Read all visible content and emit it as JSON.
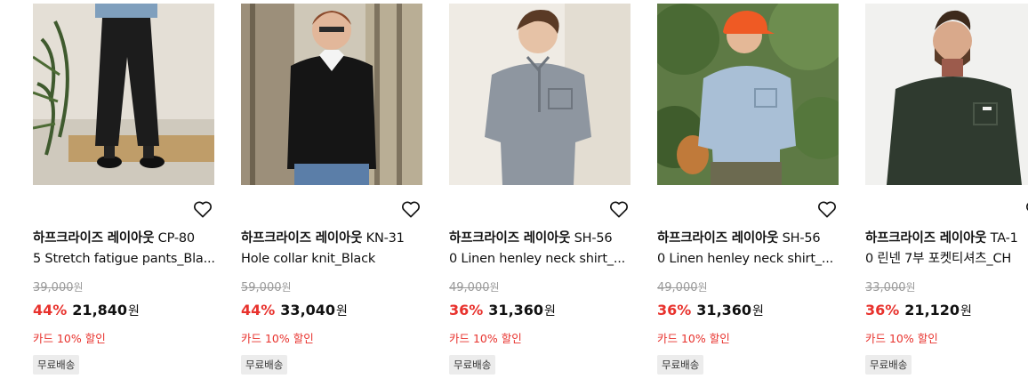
{
  "products": [
    {
      "brand": "하프크라이즈 레이아웃",
      "title_rest_line1": "CP-80",
      "title_line2": "5 Stretch fatigue pants_Bla...",
      "original_price": "39,000",
      "discount_percent": "44%",
      "sale_price": "21,840",
      "currency": "원",
      "card_discount": "카드 10% 할인",
      "shipping_badge": "무료배송",
      "image_desc": "black-pants-model",
      "favorite_icon": "heart-outline-icon"
    },
    {
      "brand": "하프크라이즈 레이아웃",
      "title_rest_line1": "KN-31",
      "title_line2": "Hole collar knit_Black",
      "original_price": "59,000",
      "discount_percent": "44%",
      "sale_price": "33,040",
      "currency": "원",
      "card_discount": "카드 10% 할인",
      "shipping_badge": "무료배송",
      "image_desc": "black-knit-model",
      "favorite_icon": "heart-outline-icon"
    },
    {
      "brand": "하프크라이즈 레이아웃",
      "title_rest_line1": "SH-56",
      "title_line2": "0 Linen henley neck shirt_...",
      "original_price": "49,000",
      "discount_percent": "36%",
      "sale_price": "31,360",
      "currency": "원",
      "card_discount": "카드 10% 할인",
      "shipping_badge": "무료배송",
      "image_desc": "grey-linen-shirt-model",
      "favorite_icon": "heart-outline-icon"
    },
    {
      "brand": "하프크라이즈 레이아웃",
      "title_rest_line1": "SH-56",
      "title_line2": "0 Linen henley neck shirt_...",
      "original_price": "49,000",
      "discount_percent": "36%",
      "sale_price": "31,360",
      "currency": "원",
      "card_discount": "카드 10% 할인",
      "shipping_badge": "무료배송",
      "image_desc": "blue-linen-shirt-cap-model",
      "favorite_icon": "heart-outline-icon"
    },
    {
      "brand": "하프크라이즈 레이아웃",
      "title_rest_line1": "TA-1",
      "title_line2": "0 린넨 7부 포켓티셔츠_CH",
      "original_price": "33,000",
      "discount_percent": "36%",
      "sale_price": "21,120",
      "currency": "원",
      "card_discount": "카드 10% 할인",
      "shipping_badge": "무료배송",
      "image_desc": "charcoal-pocket-tee-model",
      "favorite_icon": "heart-outline-icon"
    }
  ],
  "colors": {
    "discount_red": "#e8322d",
    "strike_grey": "#9a9a9a",
    "badge_bg": "#ececec"
  }
}
